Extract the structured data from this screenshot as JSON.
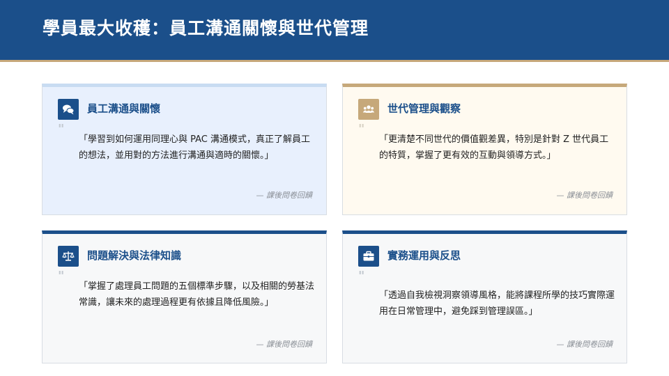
{
  "header": {
    "title": "學員最大收穫：員工溝通關懷與世代管理"
  },
  "cards": [
    {
      "icon": "chat-bubbles-icon",
      "title": "員工溝通與關懷",
      "quote": "「學習到如何運用同理心與 PAC 溝通模式，真正了解員工的想法，並用對的方法進行溝通與適時的關懷。」",
      "source": "— 課後問卷回饋"
    },
    {
      "icon": "users-group-icon",
      "title": "世代管理與觀察",
      "quote": "「更清楚不同世代的價值觀差異，特別是針對 Z 世代員工的特質，掌握了更有效的互動與領導方式。」",
      "source": "— 課後問卷回饋"
    },
    {
      "icon": "scale-balance-icon",
      "title": "問題解決與法律知識",
      "quote": "「掌握了處理員工問題的五個標準步驟，以及相關的勞基法常識，讓未來的處理過程更有依據且降低風險。」",
      "source": "— 課後問卷回饋"
    },
    {
      "icon": "briefcase-icon",
      "title": "實務運用與反思",
      "quote": "「透過自我檢視洞察領導風格，能將課程所學的技巧實際運用在日常管理中，避免踩到管理誤區。」",
      "source": "— 課後問卷回饋"
    }
  ],
  "colors": {
    "primary": "#1b4f8a",
    "accent": "#c6a87a"
  }
}
